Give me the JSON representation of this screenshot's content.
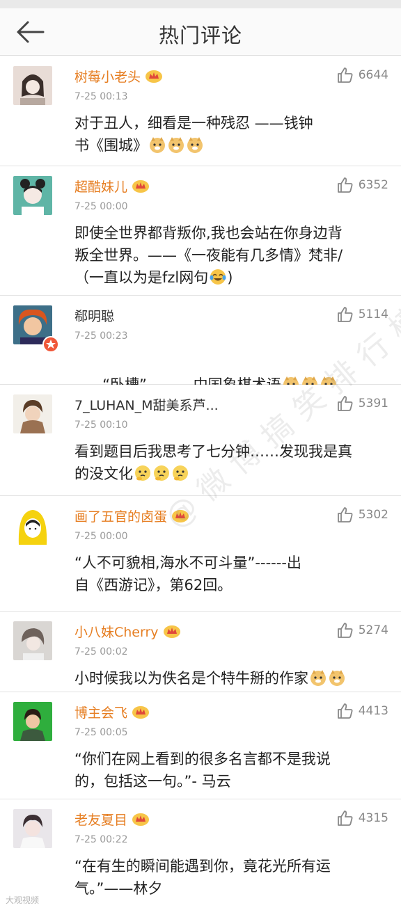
{
  "header": {
    "title": "热门评论"
  },
  "comments": [
    {
      "name": "树莓小老头",
      "time": "7-25 00:13",
      "likes": "6644",
      "text1": "对于丑人，细看是一种残忍 ——钱钟",
      "text2": "书《围城》"
    },
    {
      "name": "超酷妹儿",
      "time": "7-25 00:00",
      "likes": "6352",
      "text1": "即使全世界都背叛你,我也会站在你身边背",
      "text2": "叛全世界。——《一夜能有几多情》梵非/",
      "text3": "（一直以为是fzl网句"
    },
    {
      "name": "郗明聪",
      "time": "7-25 00:23",
      "likes": "5114",
      "text1": "“卧槽”          中国象棋术语"
    },
    {
      "name": "7_LUHAN_M甜美系芦...",
      "time": "7-25 00:10",
      "likes": "5391",
      "text1": "看到题目后我思考了七分钟……发现我是真",
      "text2": "的没文化"
    },
    {
      "name": "画了五官的卤蛋",
      "time": "7-25 00:00",
      "likes": "5302",
      "text1": "“人不可貌相,海水不可斗量”------出",
      "text2": "自《西游记》，第62回。"
    },
    {
      "name": "小八妹Cherry",
      "time": "7-25 00:02",
      "likes": "5274",
      "text1": "小时候我以为佚名是个特牛掰的作家"
    },
    {
      "name": "博主会飞",
      "time": "7-25 00:05",
      "likes": "4413",
      "text1": "“你们在网上看到的很多名言都不是我说",
      "text2": "的，包括这一句。”- 马云"
    },
    {
      "name": "老友夏目",
      "time": "7-25 00:22",
      "likes": "4315",
      "text1": "“在有生的瞬间能遇到你，竟花光所有运",
      "text2": "气。”——林夕"
    }
  ],
  "watermark": "@微博搞笑排行榜",
  "corner_mark": "大观视频",
  "colors": {
    "vip_name": "#e67e22",
    "plain_name": "#333333",
    "like_gray": "#888888",
    "divider": "#e2e2e2"
  }
}
